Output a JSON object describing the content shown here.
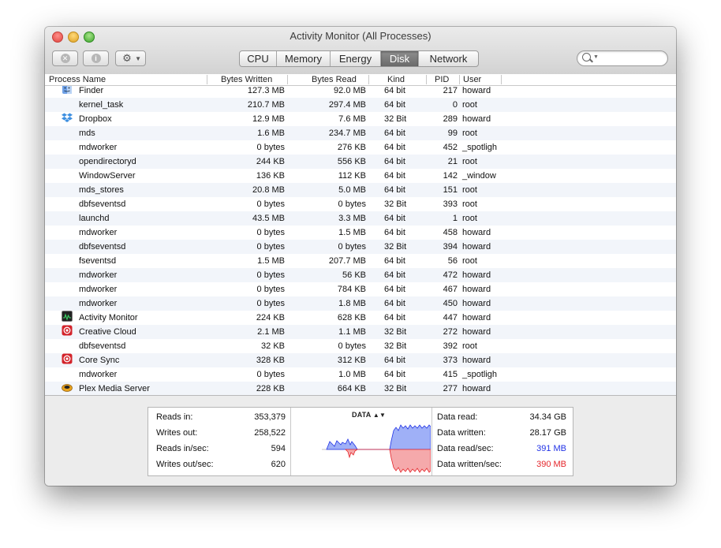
{
  "window": {
    "title": "Activity Monitor (All Processes)"
  },
  "toolbar": {
    "stop_icon": "x-circle-icon",
    "info_icon": "info-circle-icon",
    "action_icon": "gear-icon",
    "tabs": [
      {
        "label": "CPU",
        "active": false
      },
      {
        "label": "Memory",
        "active": false
      },
      {
        "label": "Energy",
        "active": false
      },
      {
        "label": "Disk",
        "active": true
      },
      {
        "label": "Network",
        "active": false
      }
    ],
    "search": {
      "value": "",
      "icon": "search-icon"
    }
  },
  "columns": {
    "name": "Process Name",
    "bytes_written": "Bytes Written",
    "bytes_read": "Bytes Read",
    "kind": "Kind",
    "pid": "PID",
    "user": "User"
  },
  "processes": [
    {
      "name": "Finder",
      "written": "127.3 MB",
      "read": "92.0 MB",
      "kind": "64 bit",
      "pid": "217",
      "user": "howard",
      "icon": "finder-icon"
    },
    {
      "name": "kernel_task",
      "written": "210.7 MB",
      "read": "297.4 MB",
      "kind": "64 bit",
      "pid": "0",
      "user": "root",
      "icon": ""
    },
    {
      "name": "Dropbox",
      "written": "12.9 MB",
      "read": "7.6 MB",
      "kind": "32 Bit",
      "pid": "289",
      "user": "howard",
      "icon": "dropbox-icon"
    },
    {
      "name": "mds",
      "written": "1.6 MB",
      "read": "234.7 MB",
      "kind": "64 bit",
      "pid": "99",
      "user": "root",
      "icon": ""
    },
    {
      "name": "mdworker",
      "written": "0 bytes",
      "read": "276 KB",
      "kind": "64 bit",
      "pid": "452",
      "user": "_spotligh",
      "icon": ""
    },
    {
      "name": "opendirectoryd",
      "written": "244 KB",
      "read": "556 KB",
      "kind": "64 bit",
      "pid": "21",
      "user": "root",
      "icon": ""
    },
    {
      "name": "WindowServer",
      "written": "136 KB",
      "read": "112 KB",
      "kind": "64 bit",
      "pid": "142",
      "user": "_window",
      "icon": ""
    },
    {
      "name": "mds_stores",
      "written": "20.8 MB",
      "read": "5.0 MB",
      "kind": "64 bit",
      "pid": "151",
      "user": "root",
      "icon": ""
    },
    {
      "name": "dbfseventsd",
      "written": "0 bytes",
      "read": "0 bytes",
      "kind": "32 Bit",
      "pid": "393",
      "user": "root",
      "icon": ""
    },
    {
      "name": "launchd",
      "written": "43.5 MB",
      "read": "3.3 MB",
      "kind": "64 bit",
      "pid": "1",
      "user": "root",
      "icon": ""
    },
    {
      "name": "mdworker",
      "written": "0 bytes",
      "read": "1.5 MB",
      "kind": "64 bit",
      "pid": "458",
      "user": "howard",
      "icon": ""
    },
    {
      "name": "dbfseventsd",
      "written": "0 bytes",
      "read": "0 bytes",
      "kind": "32 Bit",
      "pid": "394",
      "user": "howard",
      "icon": ""
    },
    {
      "name": "fseventsd",
      "written": "1.5 MB",
      "read": "207.7 MB",
      "kind": "64 bit",
      "pid": "56",
      "user": "root",
      "icon": ""
    },
    {
      "name": "mdworker",
      "written": "0 bytes",
      "read": "56 KB",
      "kind": "64 bit",
      "pid": "472",
      "user": "howard",
      "icon": ""
    },
    {
      "name": "mdworker",
      "written": "0 bytes",
      "read": "784 KB",
      "kind": "64 bit",
      "pid": "467",
      "user": "howard",
      "icon": ""
    },
    {
      "name": "mdworker",
      "written": "0 bytes",
      "read": "1.8 MB",
      "kind": "64 bit",
      "pid": "450",
      "user": "howard",
      "icon": ""
    },
    {
      "name": "Activity Monitor",
      "written": "224 KB",
      "read": "628 KB",
      "kind": "64 bit",
      "pid": "447",
      "user": "howard",
      "icon": "activity-monitor-icon"
    },
    {
      "name": "Creative Cloud",
      "written": "2.1 MB",
      "read": "1.1 MB",
      "kind": "32 Bit",
      "pid": "272",
      "user": "howard",
      "icon": "creative-cloud-icon"
    },
    {
      "name": "dbfseventsd",
      "written": "32 KB",
      "read": "0 bytes",
      "kind": "32 Bit",
      "pid": "392",
      "user": "root",
      "icon": ""
    },
    {
      "name": "Core Sync",
      "written": "328 KB",
      "read": "312 KB",
      "kind": "64 bit",
      "pid": "373",
      "user": "howard",
      "icon": "core-sync-icon"
    },
    {
      "name": "mdworker",
      "written": "0 bytes",
      "read": "1.0 MB",
      "kind": "64 bit",
      "pid": "415",
      "user": "_spotligh",
      "icon": ""
    },
    {
      "name": "Plex Media Server",
      "written": "228 KB",
      "read": "664 KB",
      "kind": "32 Bit",
      "pid": "277",
      "user": "howard",
      "icon": "plex-icon"
    }
  ],
  "summary": {
    "left": [
      {
        "label": "Reads in:",
        "value": "353,379"
      },
      {
        "label": "Writes out:",
        "value": "258,522"
      },
      {
        "label": "Reads in/sec:",
        "value": "594"
      },
      {
        "label": "Writes out/sec:",
        "value": "620"
      }
    ],
    "graph_label": "DATA",
    "right": [
      {
        "label": "Data read:",
        "value": "34.34 GB",
        "color": ""
      },
      {
        "label": "Data written:",
        "value": "28.17 GB",
        "color": ""
      },
      {
        "label": "Data read/sec:",
        "value": "391 MB",
        "color": "#2233e6"
      },
      {
        "label": "Data written/sec:",
        "value": "390 MB",
        "color": "#e5262b"
      }
    ]
  },
  "colors": {
    "read_series": "#2233e6",
    "written_series": "#e5262b",
    "active_tab": "#767676"
  }
}
